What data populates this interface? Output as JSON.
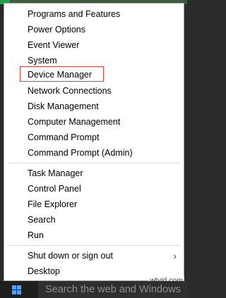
{
  "menu": {
    "groups": [
      {
        "items": [
          {
            "label": "Programs and Features"
          },
          {
            "label": "Power Options"
          },
          {
            "label": "Event Viewer"
          },
          {
            "label": "System"
          },
          {
            "label": "Device Manager",
            "highlighted": true
          },
          {
            "label": "Network Connections"
          },
          {
            "label": "Disk Management"
          },
          {
            "label": "Computer Management"
          },
          {
            "label": "Command Prompt"
          },
          {
            "label": "Command Prompt (Admin)"
          }
        ]
      },
      {
        "items": [
          {
            "label": "Task Manager"
          },
          {
            "label": "Control Panel"
          },
          {
            "label": "File Explorer"
          },
          {
            "label": "Search"
          },
          {
            "label": "Run"
          }
        ]
      },
      {
        "items": [
          {
            "label": "Shut down or sign out",
            "submenu_icon": "chevron-right-icon"
          },
          {
            "label": "Desktop"
          }
        ]
      }
    ],
    "highlight_color": "#e04040"
  },
  "taskbar": {
    "start_icon": "windows-logo-icon",
    "search_placeholder": "Search the web and Windows",
    "logo_color": "#4aa3ff"
  },
  "watermark": "wtvid.com"
}
